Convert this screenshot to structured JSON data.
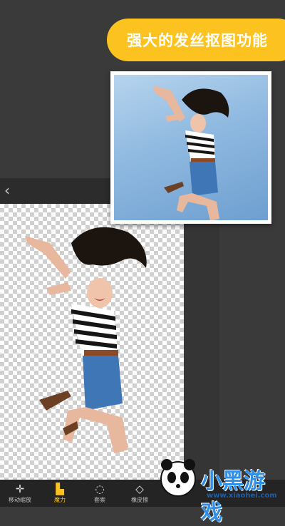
{
  "banner": {
    "text": "强大的发丝抠图功能"
  },
  "header": {
    "back_icon": "chevron-left-icon"
  },
  "toolbar": {
    "items": [
      {
        "label": "移动缩放",
        "icon": "move-icon",
        "active": false
      },
      {
        "label": "魔力",
        "icon": "magic-icon",
        "active": true
      },
      {
        "label": "套索",
        "icon": "lasso-icon",
        "active": false
      },
      {
        "label": "橡皮擦",
        "icon": "eraser-icon",
        "active": false
      }
    ]
  },
  "watermark": {
    "text": "小黑游戏",
    "url": "www.xiaohei.com"
  },
  "colors": {
    "accent": "#fcc21f",
    "background": "#3a3a3a",
    "toolbar": "#242424"
  }
}
